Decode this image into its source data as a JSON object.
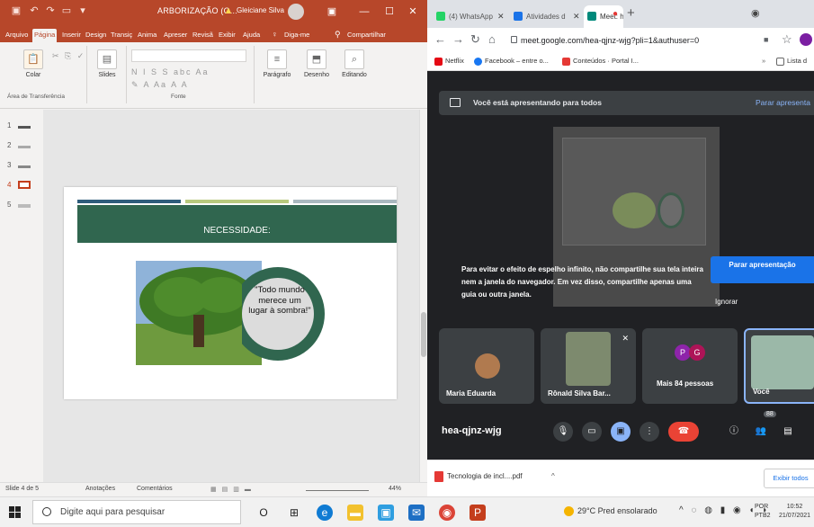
{
  "ppt": {
    "window_title": "ARBORIZAÇÃO (O...",
    "user_name": "Gleiciane Silva",
    "win_controls": [
      "—",
      "☐",
      "✕"
    ],
    "tabs": [
      "Arquivo",
      "Página",
      "Inserir",
      "Design",
      "Transiç",
      "Anima",
      "Apreser",
      "Revisã",
      "Exibir",
      "Ajuda",
      "Diga-me",
      "Compartilhar"
    ],
    "active_tab": "Página",
    "ribbon": {
      "paste_label": "Colar",
      "clipboard_group": "Área de Transferência",
      "slides_label": "Slides",
      "font_group": "Fonte",
      "paragraph_label": "Parágrafo",
      "drawing_label": "Desenho",
      "editing_label": "Editando"
    },
    "thumbs": [
      "1",
      "2",
      "3",
      "4",
      "5"
    ],
    "active_thumb": "4",
    "slide": {
      "header": "NECESSIDADE:",
      "quote": "\"Todo mundo merece um lugar à sombra!\"",
      "bar_colors": [
        "#2f5d7c",
        "#b8c97e",
        "#a9b8bf"
      ],
      "header_color": "#30664f"
    },
    "status": {
      "slide_count": "Slide 4 de 5",
      "notes": "Anotações",
      "comments": "Comentários",
      "zoom": "44%"
    }
  },
  "chrome": {
    "tabs": [
      {
        "label": "(4) WhatsApp",
        "color": "#25d366",
        "active": false
      },
      {
        "label": "Atividades d",
        "color": "#1a73e8",
        "active": false
      },
      {
        "label": "Meet: he",
        "color": "#00897b",
        "active": true
      }
    ],
    "url": "meet.google.com/hea-qjnz-wjg?pli=1&authuser=0",
    "bookmarks": [
      {
        "label": "Netflix",
        "color": "#e50914"
      },
      {
        "label": "Facebook – entre o...",
        "color": "#1877f2"
      },
      {
        "label": "Conteúdos · Portal I...",
        "color": "#e53935"
      }
    ],
    "reading_list": "Lista d",
    "downloads": {
      "file": "Tecnologia de incl....pdf",
      "show_all": "Exibir todos"
    }
  },
  "meet": {
    "banner": "Você está apresentando para todos",
    "stop_presenting_top": "Parar apresenta",
    "infinite_msg": "Para evitar o efeito de espelho infinito, não compartilhe sua tela inteira nem a janela do navegador. Em vez disso, compartilhe apenas uma guia ou outra janela.",
    "stop_presenting_btn": "Parar apresentação",
    "ignore": "Ignorar",
    "participants": [
      {
        "name": "Maria Eduarda"
      },
      {
        "name": "Rônald Silva Bar..."
      },
      {
        "name": "Mais 84 pessoas"
      },
      {
        "name": "Você"
      }
    ],
    "more_initials": [
      "P",
      "G"
    ],
    "people_count": "88",
    "meeting_code": "hea-qjnz-wjg"
  },
  "taskbar": {
    "search_placeholder": "Digite aqui para pesquisar",
    "weather": "29°C  Pred ensolarado",
    "lang": [
      "POR",
      "PTB2"
    ],
    "time": "10:52",
    "date": "21/07/2021"
  }
}
